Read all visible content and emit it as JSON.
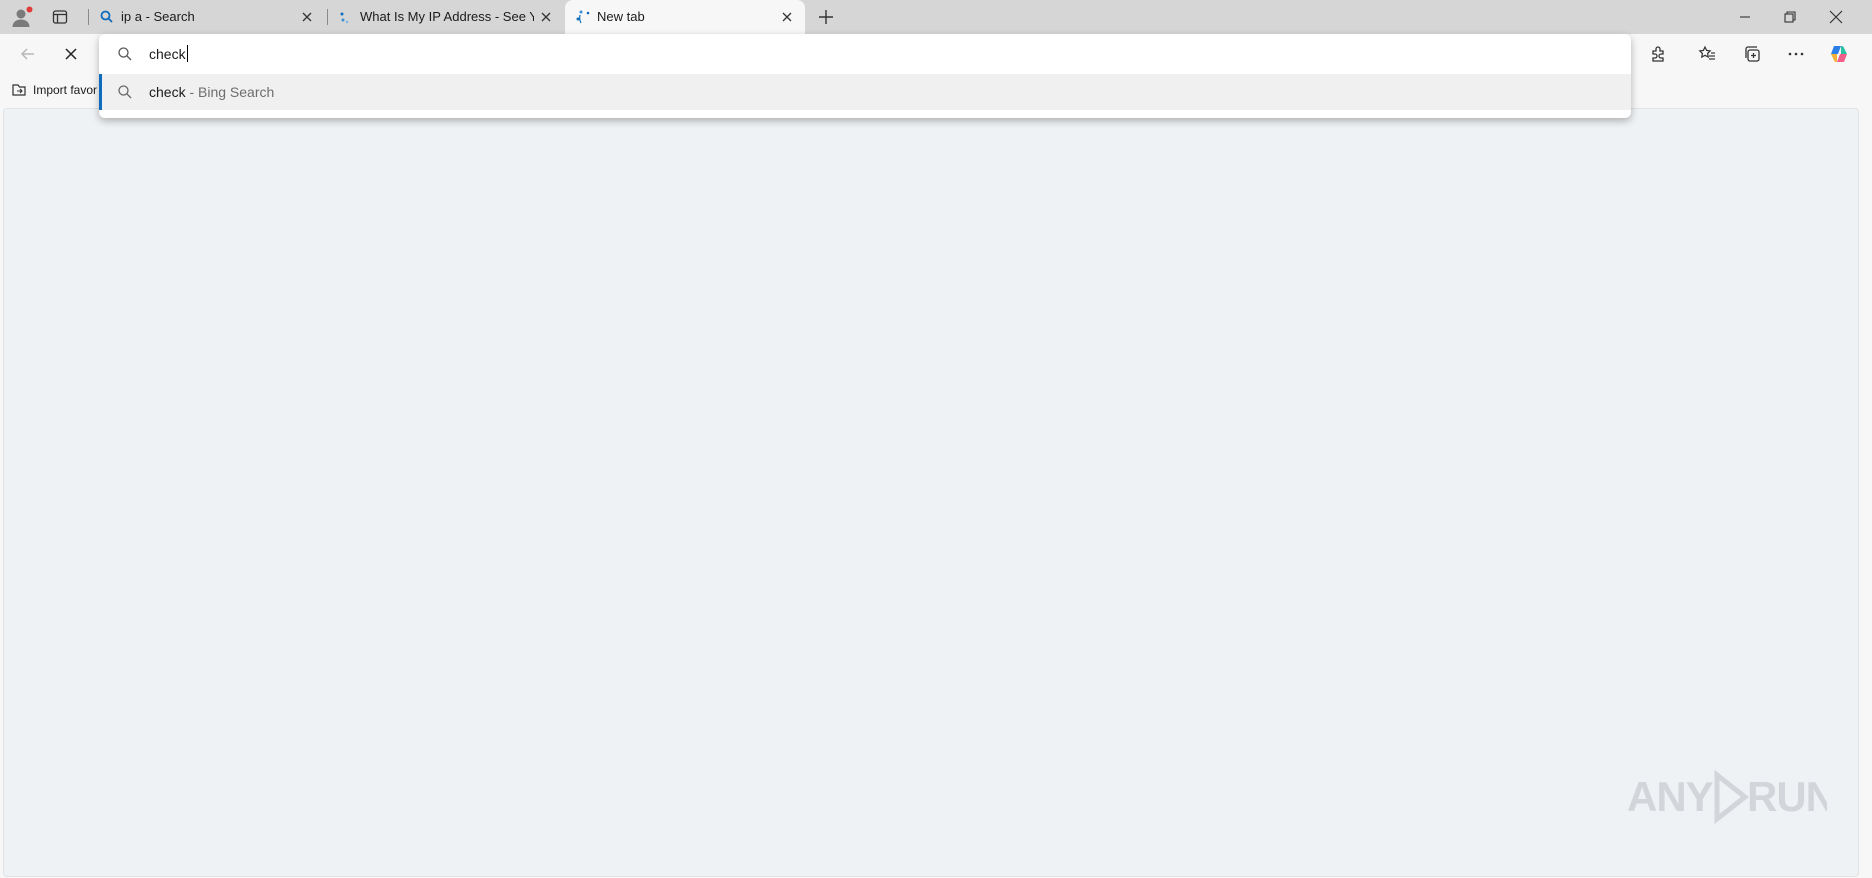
{
  "browser": {
    "tabs": [
      {
        "title": "ip a - Search",
        "active": false
      },
      {
        "title": "What Is My IP Address - See Your",
        "active": false
      },
      {
        "title": "New tab",
        "active": true
      }
    ],
    "new_tab_label": "+"
  },
  "omnibox": {
    "value": "check",
    "suggestions": [
      {
        "query": "check",
        "suffix": " - Bing Search"
      }
    ]
  },
  "favorites_bar": {
    "import_label": "Import favor"
  },
  "watermark": {
    "text": "ANY RUN"
  },
  "colors": {
    "accent": "#0f6cbd",
    "tabstrip": "#d6d6d6",
    "content_bg": "#eff2f4"
  },
  "icons": {
    "profile": "profile-icon",
    "workspaces": "workspaces-icon",
    "back": "back-arrow-icon",
    "stop": "stop-loading-icon",
    "extensions": "extensions-icon",
    "favorites": "favorites-icon",
    "collections": "collections-icon",
    "more": "more-icon",
    "copilot": "copilot-icon"
  }
}
